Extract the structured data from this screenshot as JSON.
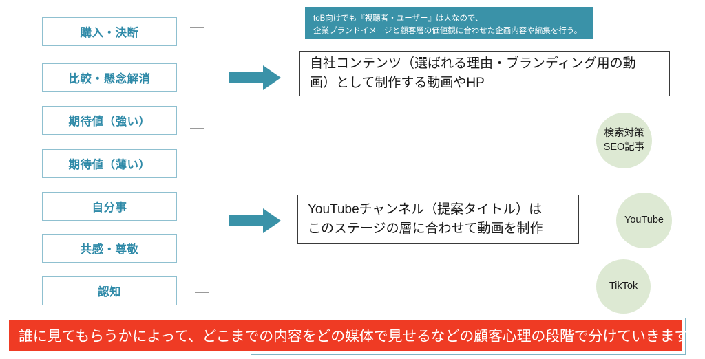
{
  "colors": {
    "stage_border": "#8fc0d0",
    "stage_text": "#2f8aa8",
    "teal_banner_bg": "#3a92a8",
    "arrow_fill": "#3a92a8",
    "circle_bg": "#dde9d3",
    "red_banner_bg": "#ef3b24",
    "bracket_stroke": "#9a9a9a",
    "content_box_border": "#3a3a3a",
    "bottom_outline_border": "#7fb6c6"
  },
  "stages": [
    {
      "label": "購入・決断"
    },
    {
      "label": "比較・懸念解消"
    },
    {
      "label": "期待値（強い）"
    },
    {
      "label": "期待値（薄い）"
    },
    {
      "label": "自分事"
    },
    {
      "label": "共感・尊敬"
    },
    {
      "label": "認知"
    }
  ],
  "teal_banner": {
    "line1": "toB向けでも『視聴者・ユーザー』は人なので、",
    "line2": "企業ブランドイメージと顧客層の価値観に合わせた企画内容や編集を行う。"
  },
  "content_boxes": [
    {
      "line1": "自社コンテンツ（選ばれる理由・ブランディング用の動",
      "line2": "画）として制作する動画やHP"
    },
    {
      "line1": "YouTubeチャンネル（提案タイトル）は",
      "line2": "このステージの層に合わせて動画を制作"
    }
  ],
  "circles": [
    {
      "line1": "検索対策",
      "line2": "SEO記事"
    },
    {
      "line1": "YouTube",
      "line2": ""
    },
    {
      "line1": "TikTok",
      "line2": ""
    }
  ],
  "red_banner": {
    "text": "誰に見てもらうかによって、どこまでの内容をどの媒体で見せるなどの顧客心理の段階で分けていきます"
  }
}
